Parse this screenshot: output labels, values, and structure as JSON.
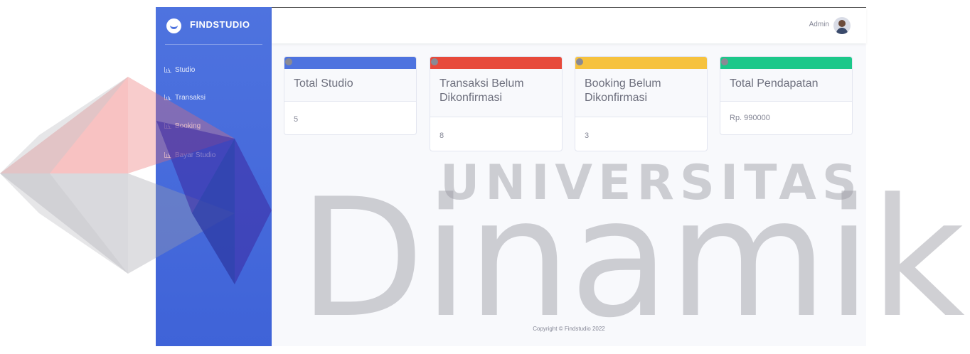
{
  "brand": {
    "name": "FINDSTUDIO",
    "icon": "laugh-wink-icon"
  },
  "sidebar": {
    "items": [
      {
        "label": "Studio",
        "icon": "chart-area-icon"
      },
      {
        "label": "Transaksi",
        "icon": "chart-area-icon"
      },
      {
        "label": "Booking",
        "icon": "chart-area-icon"
      },
      {
        "label": "Bayar Studio",
        "icon": "chart-area-icon"
      }
    ]
  },
  "topbar": {
    "user": "Admin",
    "avatar_icon": "user-avatar-icon"
  },
  "cards": [
    {
      "title": "Total Studio",
      "value": "5",
      "color": "#4e73df"
    },
    {
      "title": "Transaksi Belum Dikonfirmasi",
      "value": "8",
      "color": "#e74a3b"
    },
    {
      "title": "Booking Belum Dikonfirmasi",
      "value": "3",
      "color": "#f6c23e"
    },
    {
      "title": "Total Pendapatan",
      "value": "Rp. 990000",
      "color": "#1cc88a"
    }
  ],
  "footer": {
    "text": "Copyright © Findstudio 2022"
  },
  "watermark": {
    "line1": "UNIVERSITAS",
    "line2": "Dinamika"
  }
}
